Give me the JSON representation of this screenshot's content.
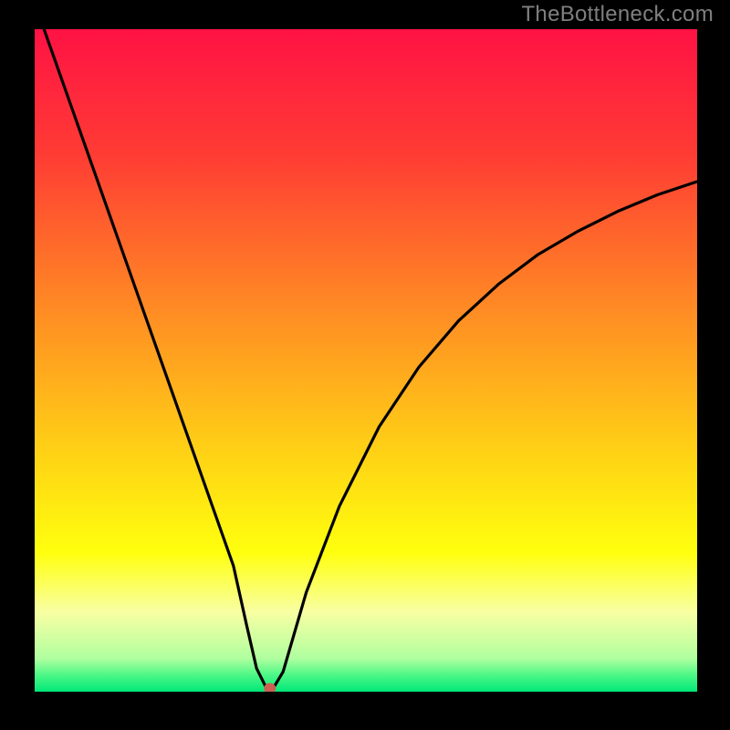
{
  "watermark": "TheBottleneck.com",
  "chart_data": {
    "type": "line",
    "title": "",
    "xlabel": "",
    "ylabel": "",
    "xlim": [
      0,
      100
    ],
    "ylim": [
      0,
      100
    ],
    "background_gradient": {
      "stops": [
        {
          "offset": 0,
          "color": "#ff1244"
        },
        {
          "offset": 0.19,
          "color": "#ff3c34"
        },
        {
          "offset": 0.42,
          "color": "#ff8a24"
        },
        {
          "offset": 0.64,
          "color": "#ffd215"
        },
        {
          "offset": 0.79,
          "color": "#ffff0e"
        },
        {
          "offset": 0.88,
          "color": "#f8ffa3"
        },
        {
          "offset": 0.95,
          "color": "#b0ff9f"
        },
        {
          "offset": 0.975,
          "color": "#4cf786"
        },
        {
          "offset": 1.0,
          "color": "#00e878"
        }
      ]
    },
    "curve": {
      "x": [
        0,
        3,
        6,
        9,
        12,
        15,
        18,
        21,
        24,
        27,
        30,
        32,
        33.5,
        35,
        36,
        37.5,
        41,
        46,
        52,
        58,
        64,
        70,
        76,
        82,
        88,
        94,
        100
      ],
      "y": [
        104,
        95.5,
        87,
        78.5,
        70,
        61.5,
        53,
        44.5,
        36,
        27.5,
        19,
        10,
        3.5,
        0.5,
        0.5,
        3,
        15,
        28,
        40,
        49,
        56,
        61.5,
        66,
        69.5,
        72.5,
        75,
        77
      ]
    },
    "marker": {
      "x": 35.5,
      "y": 0.5,
      "rx": 0.9,
      "ry": 0.8,
      "color": "#cc6052"
    }
  }
}
